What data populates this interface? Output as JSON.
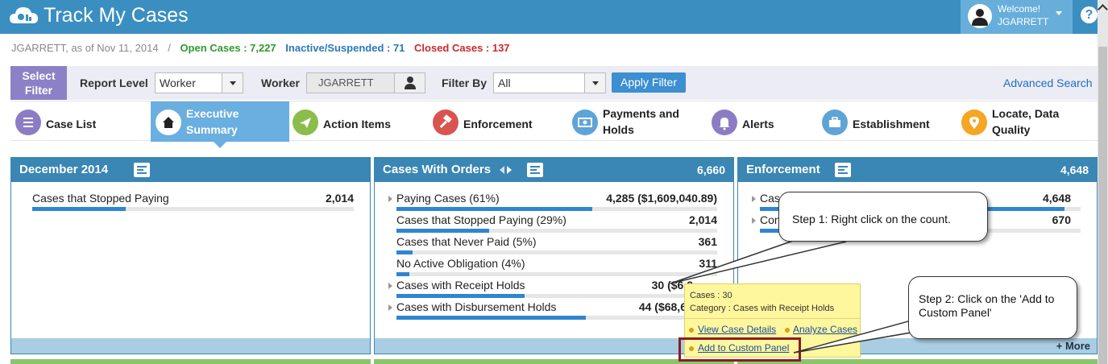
{
  "header": {
    "app_title": "Track My Cases",
    "welcome_label": "Welcome!",
    "user_name": "JGARRETT",
    "help_label": "?"
  },
  "status": {
    "user_date": "JGARRETT, as of Nov 11, 2014",
    "separator": "/",
    "open_cases": "Open Cases : 7,227",
    "inactive": "Inactive/Suspended : 71",
    "closed": "Closed Cases : 137"
  },
  "filter": {
    "select_filter": "Select Filter",
    "report_level_label": "Report Level",
    "report_level_value": "Worker",
    "worker_label": "Worker",
    "worker_value": "JGARRETT",
    "filter_by_label": "Filter By",
    "filter_by_value": "All",
    "apply_label": "Apply Filter",
    "advanced_search": "Advanced Search"
  },
  "tabs": [
    {
      "label": "Case List",
      "color": "#8c7cc4",
      "icon": "list-icon"
    },
    {
      "label": "Executive Summary",
      "color": "#ffffff",
      "icon": "home-icon"
    },
    {
      "label": "Action Items",
      "color": "#8cbc4c",
      "icon": "send-icon"
    },
    {
      "label": "Enforcement",
      "color": "#d9534f",
      "icon": "gavel-icon"
    },
    {
      "label": "Payments and Holds",
      "color": "#5ea4d6",
      "icon": "money-icon"
    },
    {
      "label": "Alerts",
      "color": "#8c7cc4",
      "icon": "bell-icon"
    },
    {
      "label": "Establishment",
      "color": "#5ea4d6",
      "icon": "briefcase-icon"
    },
    {
      "label": "Locate, Data Quality",
      "color": "#f5a623",
      "icon": "location-pin-icon"
    }
  ],
  "panels": {
    "december": {
      "title": "December 2014",
      "rows": [
        {
          "label": "Cases that Stopped Paying",
          "value": "2,014",
          "fill": 0.29
        }
      ]
    },
    "orders": {
      "title": "Cases With Orders",
      "count": "6,660",
      "rows": [
        {
          "label": "Paying Cases (61%)",
          "value": "4,285 ($1,609,040.89)",
          "fill": 0.61
        },
        {
          "label": "Cases that Stopped Paying (29%)",
          "value": "2,014",
          "fill": 0.29
        },
        {
          "label": "Cases that Never Paid (5%)",
          "value": "361",
          "fill": 0.05
        },
        {
          "label": "No Active Obligation (4%)",
          "value": "311",
          "fill": 0.04
        },
        {
          "label": "Cases with Receipt Holds",
          "value": "30 ($6,2",
          "fill": 0.4
        },
        {
          "label": "Cases with Disbursement Holds",
          "value": "44 ($68,6",
          "fill": 0.59
        }
      ]
    },
    "enforcement": {
      "title": "Enforcement",
      "count": "4,648",
      "rows": [
        {
          "label": "Case",
          "value": "4,648",
          "fill": 0.95
        },
        {
          "label": "Con",
          "value": "670",
          "fill": 0.14
        }
      ],
      "more": "+ More"
    }
  },
  "tooltip": {
    "cases": "Cases : 30",
    "category": "Category : Cases with Receipt Holds",
    "view_details": "View Case Details",
    "analyze": "Analyze Cases",
    "add_custom": "Add to Custom Panel"
  },
  "callouts": {
    "step1": "Step 1: Right click on the count.",
    "step2": "Step 2: Click on the 'Add to Custom Panel'"
  }
}
